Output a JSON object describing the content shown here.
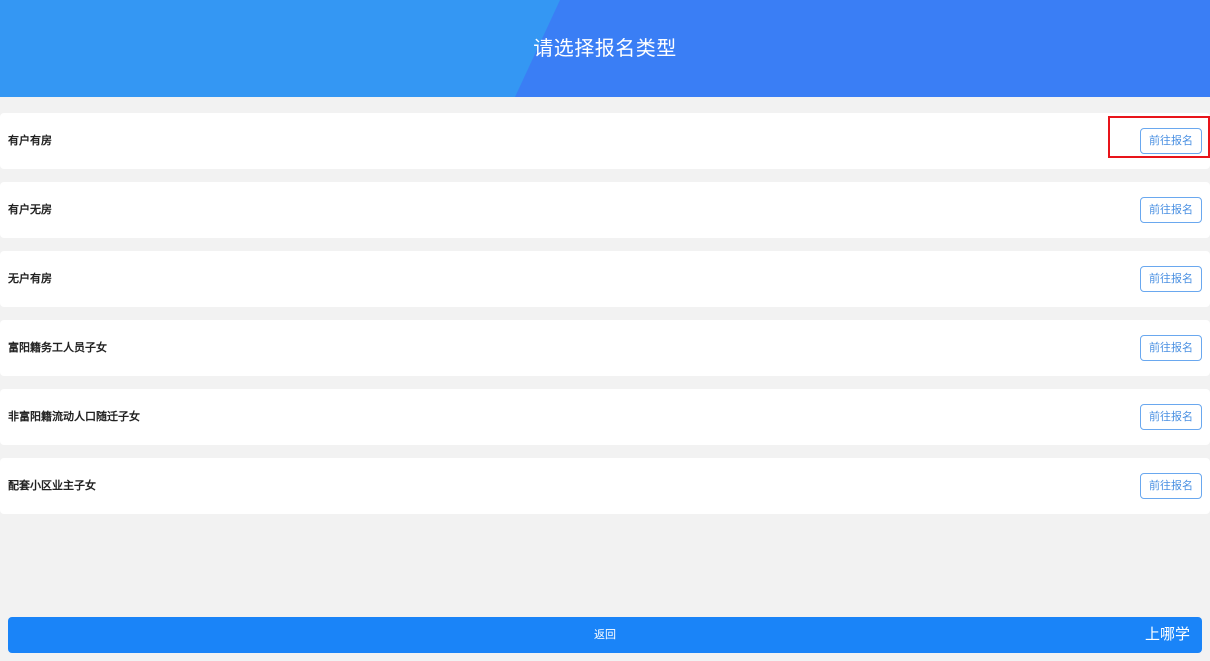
{
  "header": {
    "title": "请选择报名类型"
  },
  "categories": [
    {
      "label": "有户有房",
      "button_label": "前往报名",
      "highlighted": true
    },
    {
      "label": "有户无房",
      "button_label": "前往报名",
      "highlighted": false
    },
    {
      "label": "无户有房",
      "button_label": "前往报名",
      "highlighted": false
    },
    {
      "label": "富阳籍务工人员子女",
      "button_label": "前往报名",
      "highlighted": false
    },
    {
      "label": "非富阳籍流动人口随迁子女",
      "button_label": "前往报名",
      "highlighted": false
    },
    {
      "label": "配套小区业主子女",
      "button_label": "前往报名",
      "highlighted": false
    }
  ],
  "footer": {
    "return_label": "返回",
    "watermark": "上哪学"
  },
  "colors": {
    "header_left": "#3497f3",
    "header_right": "#3a7ef5",
    "button_border": "#6aa8ef",
    "button_text": "#4a90e2",
    "return_bar": "#1a84f8",
    "highlight": "#e8141a",
    "page_bg": "#f2f2f2"
  }
}
